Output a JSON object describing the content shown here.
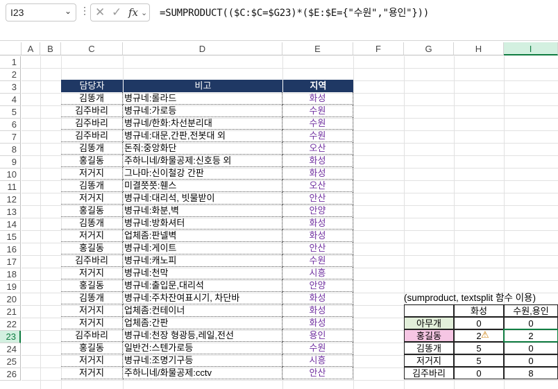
{
  "formula_bar": {
    "name_box": "I23",
    "formula": "=SUMPRODUCT(($C:$C=$G23)*($E:$E={\"수원\",\"용인\"}))",
    "cancel_icon": "x-icon",
    "enter_icon": "check-icon",
    "fx_label": "fx"
  },
  "columns": [
    "A",
    "B",
    "C",
    "D",
    "E",
    "F",
    "G",
    "H",
    "I"
  ],
  "rows": [
    "1",
    "2",
    "3",
    "4",
    "5",
    "6",
    "7",
    "8",
    "9",
    "10",
    "11",
    "12",
    "13",
    "14",
    "15",
    "16",
    "17",
    "18",
    "19",
    "20",
    "21",
    "22",
    "23",
    "24",
    "25",
    "26"
  ],
  "table": {
    "headers": [
      "담당자",
      "비고",
      "지역"
    ],
    "rows": [
      [
        "김똥개",
        "병규네:롤라드",
        "화성"
      ],
      [
        "김주바리",
        "병규네:가로등",
        "수원"
      ],
      [
        "김주바리",
        "병규네/한화:차선분리대",
        "수원"
      ],
      [
        "김주바리",
        "병규네:대문,간판,전봇대 외",
        "수원"
      ],
      [
        "김똥개",
        "돈줘:중앙화단",
        "오산"
      ],
      [
        "홍길동",
        "주하니네/화물공제:신호등 외",
        "화성"
      ],
      [
        "저거지",
        "그나마:신이철강 간판",
        "화성"
      ],
      [
        "김똥개",
        "미결쯧쯧:휀스",
        "오산"
      ],
      [
        "저거지",
        "병규네:대리석, 빗물받이",
        "안산"
      ],
      [
        "홍길동",
        "병규네:화분,벽",
        "안양"
      ],
      [
        "김똥개",
        "병규네:방화셔터",
        "화성"
      ],
      [
        "저거지",
        "업체좀:판넬벽",
        "화성"
      ],
      [
        "홍길동",
        "병규네:게이트",
        "안산"
      ],
      [
        "김주바리",
        "병규네:캐노피",
        "수원"
      ],
      [
        "저거지",
        "병규네:천막",
        "시흥"
      ],
      [
        "홍길동",
        "병규네:출입문,대리석",
        "안양"
      ],
      [
        "김똥개",
        "병규네:주차잔여표시기, 차단바",
        "화성"
      ],
      [
        "저거지",
        "업체좀:컨테이너",
        "화성"
      ],
      [
        "저거지",
        "업체좀:간판",
        "화성"
      ],
      [
        "김주바리",
        "병규네:천장 형광등,레일,전선",
        "용인"
      ],
      [
        "홍길동",
        "일반건:스텐가로등",
        "수원"
      ],
      [
        "저거지",
        "병규네:조명기구등",
        "시흥"
      ],
      [
        "저거지",
        "주하니네/화물공제:cctv",
        "안산"
      ]
    ]
  },
  "summary": {
    "title": "(sumproduct, textsplit 함수 이용)",
    "col_headers": [
      "화성",
      "수원,용인"
    ],
    "rows": [
      {
        "name": "아무개",
        "a": "0",
        "b": "0"
      },
      {
        "name": "홍길동",
        "a": "2",
        "b": "2"
      },
      {
        "name": "김똥개",
        "a": "5",
        "b": "0"
      },
      {
        "name": "저거지",
        "a": "5",
        "b": "0"
      },
      {
        "name": "김주바리",
        "a": "0",
        "b": "8"
      }
    ]
  },
  "colors": {
    "header_bg": "#1f3864",
    "region_text": "#7030a0",
    "selection": "#107c41",
    "green_fill": "#e2efda",
    "pink_fill": "#f6c6e4"
  }
}
